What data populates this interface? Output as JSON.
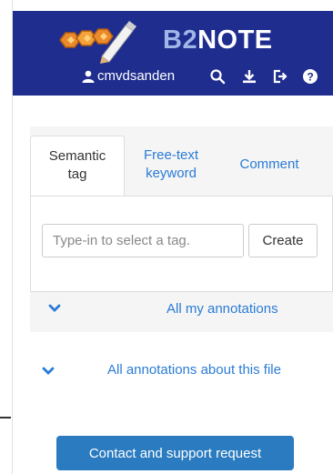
{
  "header": {
    "brand_prefix": "B2",
    "brand_suffix": "NOTE",
    "username": "cmvdsanden"
  },
  "toolbar": {
    "icons": [
      "user-icon",
      "search-icon",
      "download-icon",
      "logout-icon",
      "help-icon"
    ]
  },
  "tabs": [
    {
      "label_line1": "Semantic",
      "label_line2": "tag",
      "active": true
    },
    {
      "label_line1": "Free-text",
      "label_line2": "keyword",
      "active": false
    },
    {
      "label_line1": "Comment",
      "label_line2": "",
      "active": false
    }
  ],
  "semantic_tag": {
    "placeholder": "Type-in to select a tag.",
    "create_label": "Create"
  },
  "sections": {
    "my_annotations": "All my annotations",
    "file_annotations": "All annotations about this file"
  },
  "support": {
    "button_label": "Contact and support request"
  },
  "colors": {
    "header_bg": "#1f2d8f",
    "link": "#2a7bd5",
    "button_bg": "#2a7bc0",
    "panel_bg": "#f5f5f5"
  }
}
